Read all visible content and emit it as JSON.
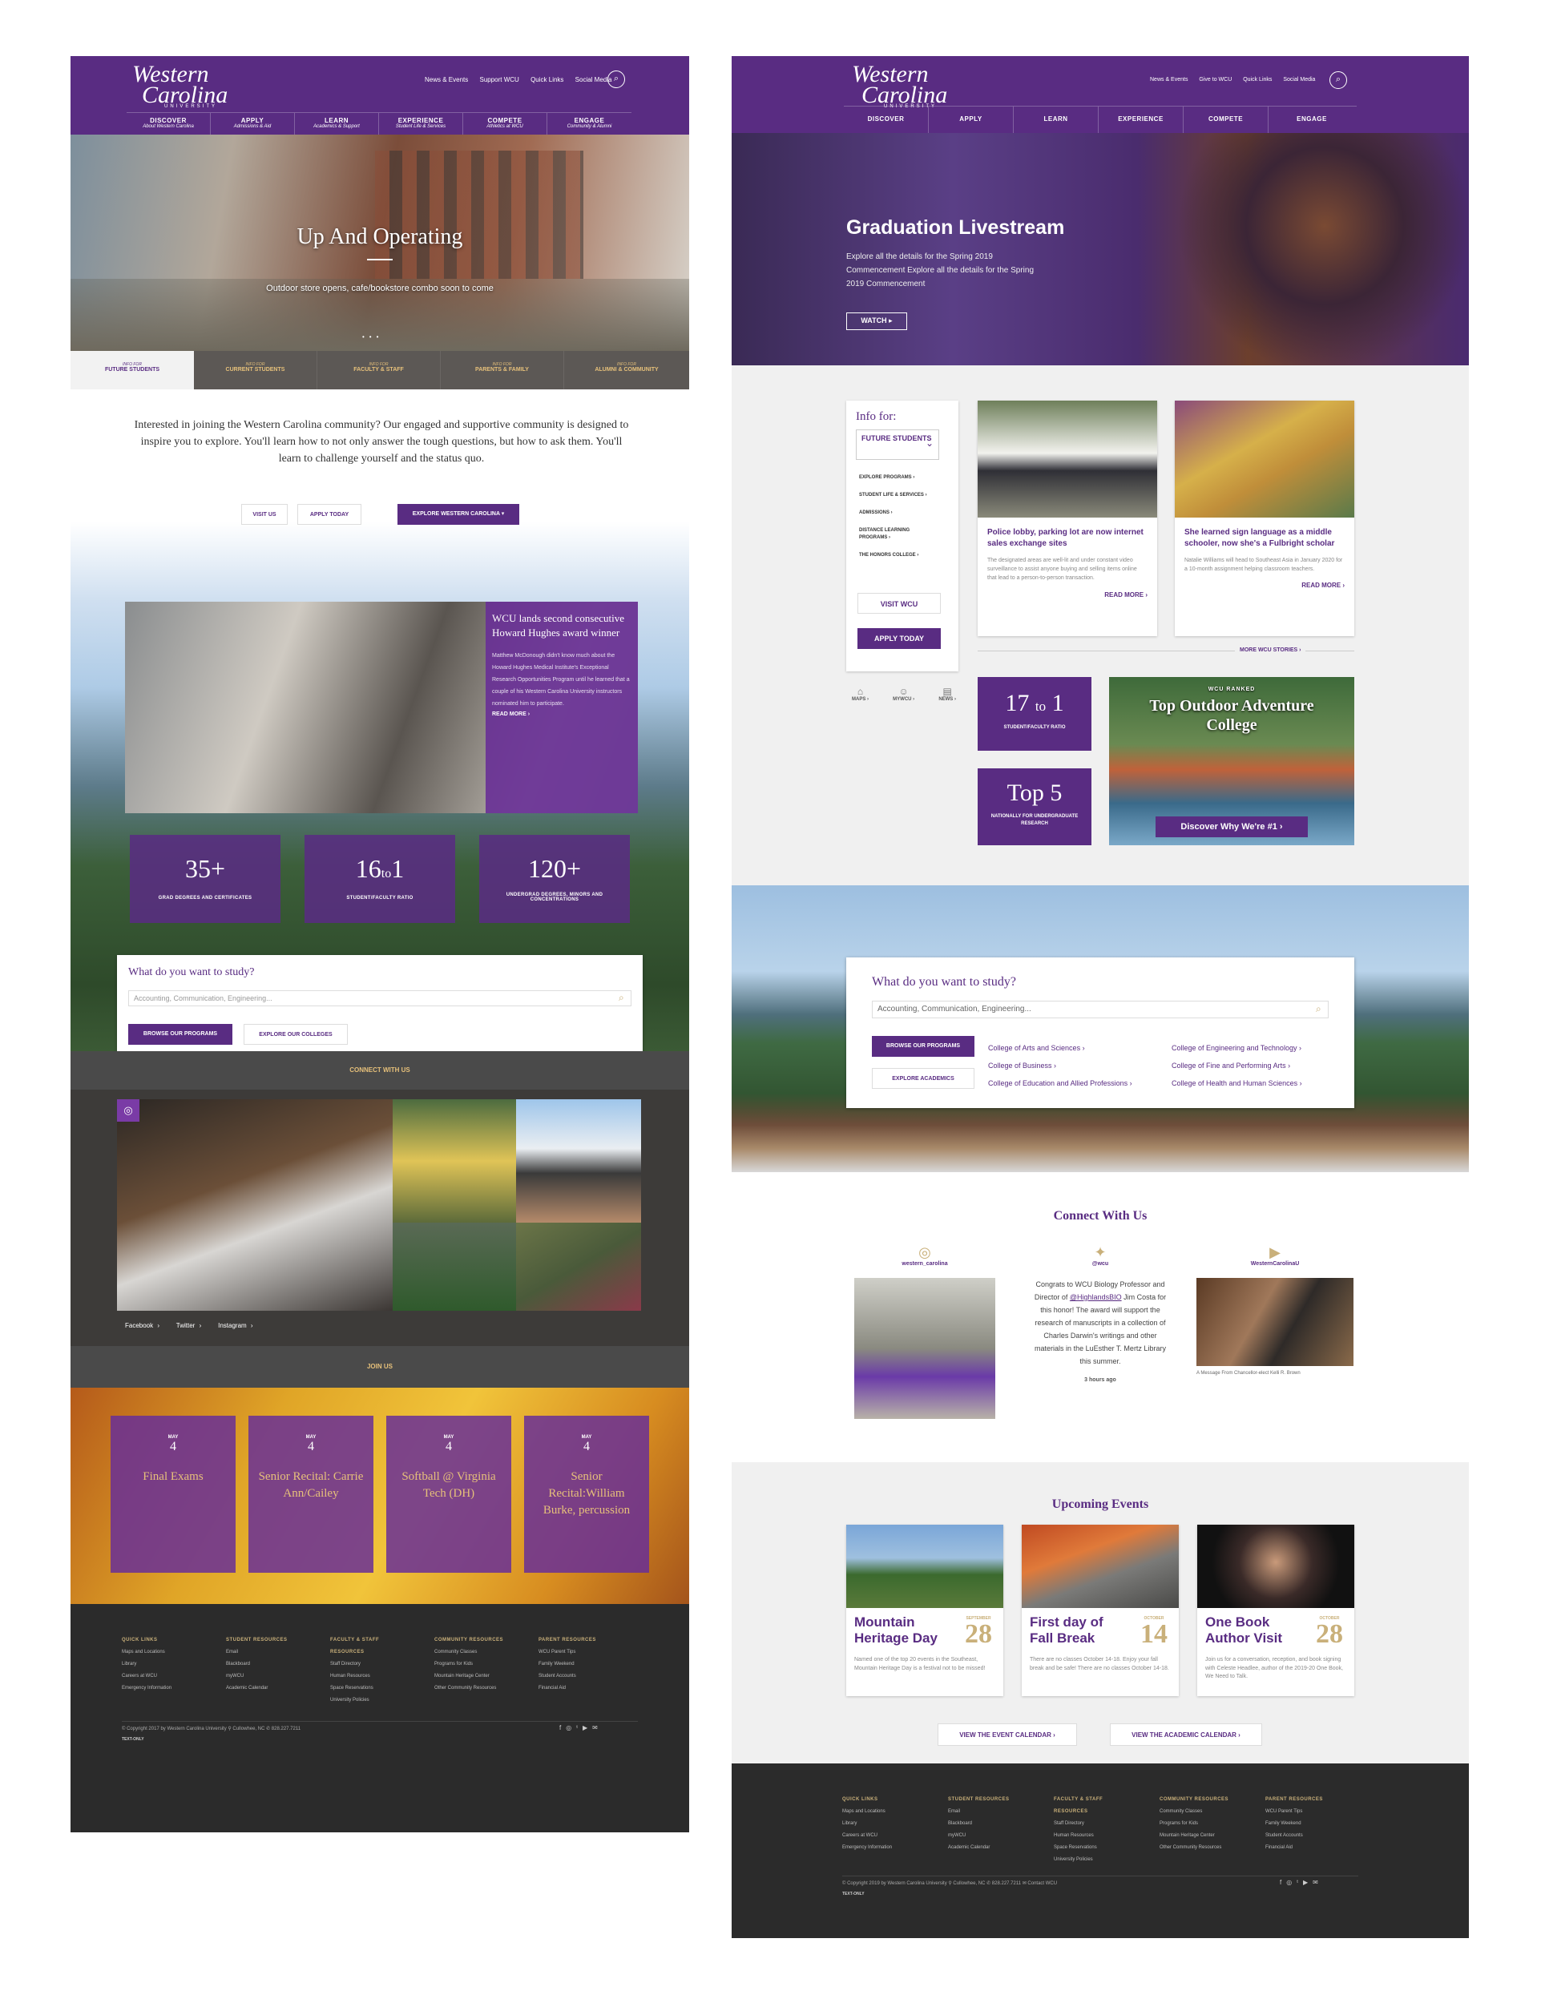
{
  "left": {
    "header": {
      "logo": {
        "line1": "Western",
        "line2": "Carolina",
        "line3": "UNIVERSITY"
      },
      "utility_links": [
        "News & Events",
        "Support WCU",
        "Quick Links",
        "Social Media"
      ]
    },
    "nav": [
      {
        "label": "DISCOVER",
        "sub": "About Western Carolina"
      },
      {
        "label": "APPLY",
        "sub": "Admissions & Aid"
      },
      {
        "label": "LEARN",
        "sub": "Academics & Support"
      },
      {
        "label": "EXPERIENCE",
        "sub": "Student Life & Services"
      },
      {
        "label": "COMPETE",
        "sub": "Athletics at WCU"
      },
      {
        "label": "ENGAGE",
        "sub": "Community & Alumni"
      }
    ],
    "hero": {
      "title": "Up And Operating",
      "subtitle": "Outdoor store opens, cafe/bookstore combo soon to come"
    },
    "info_tabs": [
      {
        "pre": "INFO FOR",
        "label": "FUTURE STUDENTS"
      },
      {
        "pre": "INFO FOR",
        "label": "CURRENT STUDENTS"
      },
      {
        "pre": "INFO FOR",
        "label": "FACULTY & STAFF"
      },
      {
        "pre": "INFO FOR",
        "label": "PARENTS & FAMILY"
      },
      {
        "pre": "INFO FOR",
        "label": "ALUMNI & COMMUNITY"
      }
    ],
    "intro": "Interested in joining the Western Carolina community? Our engaged and supportive community is designed to inspire you to explore. You'll learn how to not only answer the tough questions, but how to ask them. You'll learn to challenge yourself and the status quo.",
    "cta": {
      "visit": "VISIT US",
      "apply": "APPLY TODAY",
      "explore": "EXPLORE WESTERN CAROLINA ▾"
    },
    "feature": {
      "title": "WCU lands second consecutive Howard Hughes award winner",
      "body": "Matthew McDonough didn't know much about the Howard Hughes Medical Institute's Exceptional Research Opportunities Program until he learned that a couple of his Western Carolina University instructors nominated him to participate.",
      "read_more": "READ MORE ›"
    },
    "stats": [
      {
        "number": "35+",
        "label": "GRAD DEGREES AND CERTIFICATES"
      },
      {
        "number": "16",
        "to": "to",
        "number2": "1",
        "label": "STUDENT/FACULTY RATIO"
      },
      {
        "number": "120+",
        "label": "UNDERGRAD DEGREES, MINORS AND CONCENTRATIONS"
      }
    ],
    "study": {
      "title": "What do you want to study?",
      "placeholder": "Accounting, Communication, Engineering...",
      "browse": "BROWSE OUR PROGRAMS",
      "explore": "EXPLORE OUR COLLEGES"
    },
    "connect_title": "CONNECT WITH US",
    "social_links": [
      "Facebook ›",
      "Twitter ›",
      "Instagram ›"
    ],
    "join_title": "JOIN US",
    "events": [
      {
        "month": "MAY",
        "day": "4",
        "title": "Final Exams"
      },
      {
        "month": "MAY",
        "day": "4",
        "title": "Senior Recital: Carrie Ann/Cailey"
      },
      {
        "month": "MAY",
        "day": "4",
        "title": "Softball @ Virginia Tech (DH)"
      },
      {
        "month": "MAY",
        "day": "4",
        "title": "Senior Recital:William Burke, percussion"
      }
    ],
    "footer": {
      "cols": [
        {
          "head": "QUICK LINKS",
          "items": [
            "Maps and Locations",
            "Library",
            "Careers at WCU",
            "Emergency Information"
          ]
        },
        {
          "head": "STUDENT RESOURCES",
          "items": [
            "Email",
            "Blackboard",
            "myWCU",
            "Academic Calendar"
          ]
        },
        {
          "head": "FACULTY & STAFF RESOURCES",
          "items": [
            "Staff Directory",
            "Human Resources",
            "Space Reservations",
            "University Policies"
          ]
        },
        {
          "head": "COMMUNITY RESOURCES",
          "items": [
            "Community Classes",
            "Programs for Kids",
            "Mountain Heritage Center",
            "Other Community Resources"
          ]
        },
        {
          "head": "PARENT RESOURCES",
          "items": [
            "WCU Parent Tips",
            "Family Weekend",
            "Student Accounts",
            "Financial Aid"
          ]
        }
      ],
      "copyright": "© Copyright 2017 by Western Carolina University  ⚲ Cullowhee, NC  ✆ 828.227.7211",
      "text_only": "TEXT-ONLY"
    }
  },
  "right": {
    "header": {
      "logo": {
        "line1": "Western",
        "line2": "Carolina",
        "line3": "UNIVERSITY"
      },
      "utility_links": [
        "News & Events",
        "Give to WCU",
        "Quick Links",
        "Social Media"
      ]
    },
    "nav": [
      "DISCOVER",
      "APPLY",
      "LEARN",
      "EXPERIENCE",
      "COMPETE",
      "ENGAGE"
    ],
    "hero": {
      "title": "Graduation Livestream",
      "body": "Explore all the details for the Spring 2019 Commencement Explore all the details for the Spring 2019 Commencement",
      "button": "WATCH ▸"
    },
    "info": {
      "label": "Info for:",
      "selected": "FUTURE STUDENTS",
      "links": [
        "EXPLORE PROGRAMS ›",
        "STUDENT LIFE & SERVICES ›",
        "ADMISSIONS ›",
        "DISTANCE LEARNING PROGRAMS ›",
        "THE HONORS COLLEGE ›"
      ],
      "visit": "VISIT WCU",
      "apply": "APPLY TODAY",
      "icons": [
        {
          "label": "MAPS ›"
        },
        {
          "label": "MYWCU ›"
        },
        {
          "label": "NEWS ›"
        }
      ]
    },
    "stories": [
      {
        "title": "Police lobby, parking lot are now internet sales exchange sites",
        "body": "The designated areas are well-lit and under constant video surveillance to assist anyone buying and selling items online that lead to a person-to-person transaction.",
        "read_more": "READ MORE ›"
      },
      {
        "title": "She learned sign language as a middle schooler, now she's a Fulbright scholar",
        "body": "Natalie Williams will head to Southeast Asia in January 2020 for a 10-month assignment helping classroom teachers.",
        "read_more": "READ MORE ›"
      }
    ],
    "more_stories": "MORE WCU STORIES ›",
    "stats": [
      {
        "number": "17",
        "to": "to",
        "number2": "1",
        "label": "STUDENT/FACULTY RATIO"
      },
      {
        "number": "Top 5",
        "label": "NATIONALLY FOR UNDERGRADUATE RESEARCH"
      }
    ],
    "ranked": {
      "pre": "WCU RANKED",
      "title": "Top Outdoor Adventure College",
      "button": "Discover Why We're #1 ›"
    },
    "study": {
      "title": "What do you want to study?",
      "placeholder": "Accounting, Communication, Engineering...",
      "browse": "BROWSE OUR PROGRAMS",
      "explore": "EXPLORE ACADEMICS",
      "colleges_left": [
        "College of Arts and Sciences ›",
        "College of Business ›",
        "College of Education and Allied Professions ›"
      ],
      "colleges_right": [
        "College of Engineering and Technology ›",
        "College of Fine and Performing Arts ›",
        "College of Health and Human Sciences ›"
      ]
    },
    "connect": {
      "title": "Connect With Us",
      "instagram": "western_carolina",
      "twitter": "@wcu",
      "youtube": "WesternCarolinaU",
      "tweet_pre": "Congrats to WCU Biology Professor and Director of ",
      "tweet_handle": "@HighlandsBIO",
      "tweet_post": " Jim Costa for this honor! The award will support the research of manuscripts in a collection of Charles Darwin's writings and other materials in the LuEsther T. Mertz Library this summer.",
      "tweet_time": "3 hours ago",
      "video_caption": "A Message From Chancellor-elect Kelli R. Brown"
    },
    "events": {
      "title": "Upcoming Events",
      "items": [
        {
          "title": "Mountain Heritage Day",
          "month": "SEPTEMBER",
          "day": "28",
          "body": "Named one of the top 20 events in the Southeast, Mountain Heritage Day is a festival not to be missed!"
        },
        {
          "title": "First day of Fall Break",
          "month": "OCTOBER",
          "day": "14",
          "body": "There are no classes October 14-18. Enjoy your fall break and be safe! There are no classes October 14-18."
        },
        {
          "title": "One Book Author Visit",
          "month": "OCTOBER",
          "day": "28",
          "body": "Join us for a conversation, reception, and book signing with Celeste Headlee, author of the 2019-20 One Book, We Need to Talk."
        }
      ],
      "event_calendar": "VIEW THE EVENT CALENDAR ›",
      "academic_calendar": "VIEW THE ACADEMIC CALENDAR ›"
    },
    "footer": {
      "cols": [
        {
          "head": "QUICK LINKS",
          "items": [
            "Maps and Locations",
            "Library",
            "Careers at WCU",
            "Emergency Information"
          ]
        },
        {
          "head": "STUDENT RESOURCES",
          "items": [
            "Email",
            "Blackboard",
            "myWCU",
            "Academic Calendar"
          ]
        },
        {
          "head": "FACULTY & STAFF RESOURCES",
          "items": [
            "Staff Directory",
            "Human Resources",
            "Space Reservations",
            "University Policies"
          ]
        },
        {
          "head": "COMMUNITY RESOURCES",
          "items": [
            "Community Classes",
            "Programs for Kids",
            "Mountain Heritage Center",
            "Other Community Resources"
          ]
        },
        {
          "head": "PARENT RESOURCES",
          "items": [
            "WCU Parent Tips",
            "Family Weekend",
            "Student Accounts",
            "Financial Aid"
          ]
        }
      ],
      "copyright": "© Copyright 2019 by Western Carolina University  ⚲ Cullowhee, NC  ✆ 828.227.7211  ✉ Contact WCU",
      "text_only": "TEXT-ONLY"
    }
  },
  "colors": {
    "purple": "#592c82",
    "gold": "#c9b07a",
    "dark": "#2b2b2b",
    "gray_bar": "#4a4a4a"
  },
  "icons": [
    "search-icon",
    "instagram-icon",
    "twitter-icon",
    "youtube-icon",
    "facebook-icon",
    "map-icon",
    "user-icon",
    "news-icon",
    "chevron-down-icon"
  ]
}
